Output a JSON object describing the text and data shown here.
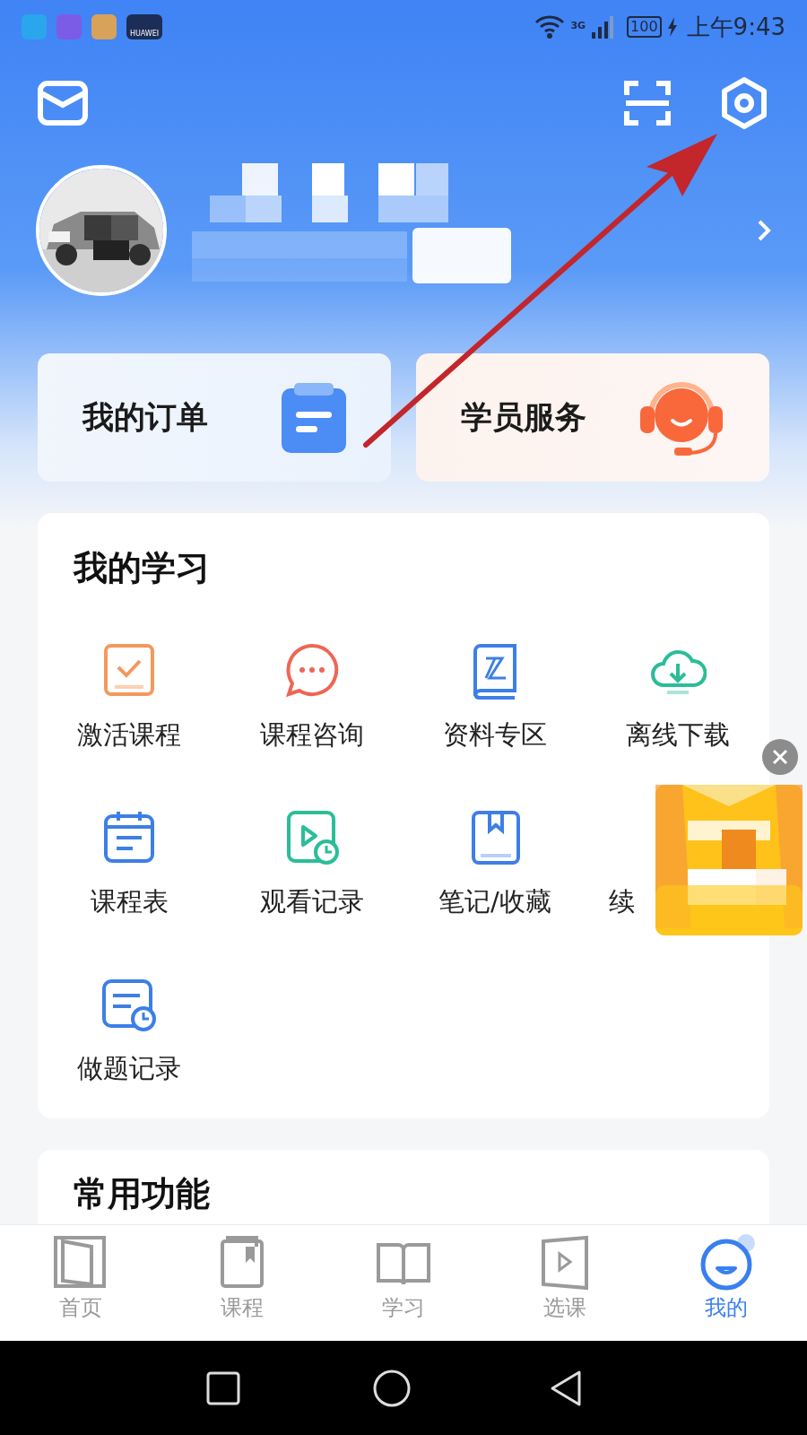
{
  "status_bar": {
    "app_icon_label": "HUAWEI",
    "network": "3G",
    "battery": "100",
    "time": "上午9:43"
  },
  "quick_cards": [
    {
      "label": "我的订单"
    },
    {
      "label": "学员服务"
    }
  ],
  "study": {
    "title": "我的学习",
    "items": [
      {
        "label": "激活课程",
        "covered": false
      },
      {
        "label": "课程咨询",
        "covered": false
      },
      {
        "label": "资料专区",
        "covered": false
      },
      {
        "label": "离线下载",
        "covered": false
      },
      {
        "label": "课程表",
        "covered": false
      },
      {
        "label": "观看记录",
        "covered": false
      },
      {
        "label": "笔记/收藏",
        "covered": false
      },
      {
        "label": "续",
        "covered": true
      },
      {
        "label": "做题记录",
        "covered": false
      }
    ]
  },
  "common": {
    "title": "常用功能"
  },
  "tab_bar": [
    {
      "label": "首页",
      "selected": false
    },
    {
      "label": "课程",
      "selected": false
    },
    {
      "label": "学习",
      "selected": false
    },
    {
      "label": "选课",
      "selected": false
    },
    {
      "label": "我的",
      "selected": true
    }
  ]
}
